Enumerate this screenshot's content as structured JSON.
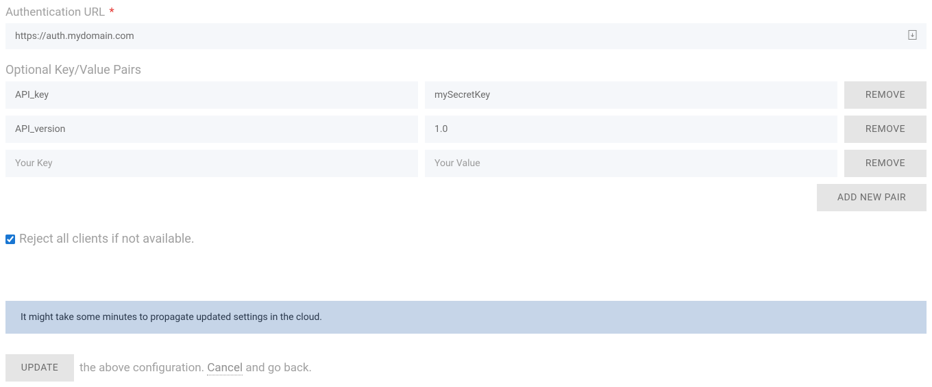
{
  "auth": {
    "label": "Authentication URL",
    "required_marker": "*",
    "value": "https://auth.mydomain.com"
  },
  "kv": {
    "section_label": "Optional Key/Value Pairs",
    "remove_label": "REMOVE",
    "add_label": "ADD NEW PAIR",
    "key_placeholder": "Your Key",
    "value_placeholder": "Your Value",
    "rows": [
      {
        "key": "API_key",
        "value": "mySecretKey"
      },
      {
        "key": "API_version",
        "value": "1.0"
      },
      {
        "key": "",
        "value": ""
      }
    ]
  },
  "reject": {
    "label": "Reject all clients if not available.",
    "checked": true
  },
  "banner": {
    "text": "It might take some minutes to propagate updated settings in the cloud."
  },
  "footer": {
    "update_label": "UPDATE",
    "text_before_cancel": " the above configuration. ",
    "cancel_label": "Cancel",
    "text_after_cancel": " and go back."
  }
}
